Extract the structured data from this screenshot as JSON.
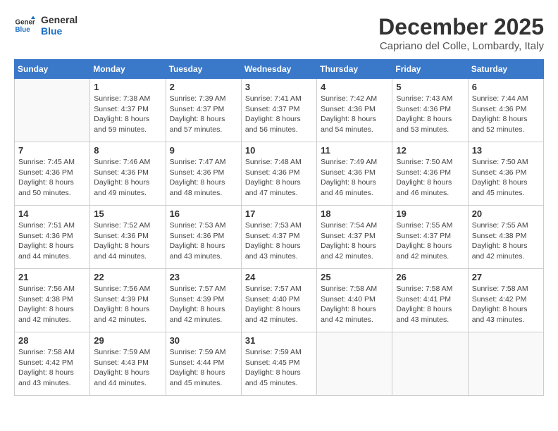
{
  "header": {
    "logo_line1": "General",
    "logo_line2": "Blue",
    "month_title": "December 2025",
    "subtitle": "Capriano del Colle, Lombardy, Italy"
  },
  "weekdays": [
    "Sunday",
    "Monday",
    "Tuesday",
    "Wednesday",
    "Thursday",
    "Friday",
    "Saturday"
  ],
  "weeks": [
    [
      {
        "day": "",
        "info": ""
      },
      {
        "day": "1",
        "info": "Sunrise: 7:38 AM\nSunset: 4:37 PM\nDaylight: 8 hours\nand 59 minutes."
      },
      {
        "day": "2",
        "info": "Sunrise: 7:39 AM\nSunset: 4:37 PM\nDaylight: 8 hours\nand 57 minutes."
      },
      {
        "day": "3",
        "info": "Sunrise: 7:41 AM\nSunset: 4:37 PM\nDaylight: 8 hours\nand 56 minutes."
      },
      {
        "day": "4",
        "info": "Sunrise: 7:42 AM\nSunset: 4:36 PM\nDaylight: 8 hours\nand 54 minutes."
      },
      {
        "day": "5",
        "info": "Sunrise: 7:43 AM\nSunset: 4:36 PM\nDaylight: 8 hours\nand 53 minutes."
      },
      {
        "day": "6",
        "info": "Sunrise: 7:44 AM\nSunset: 4:36 PM\nDaylight: 8 hours\nand 52 minutes."
      }
    ],
    [
      {
        "day": "7",
        "info": "Sunrise: 7:45 AM\nSunset: 4:36 PM\nDaylight: 8 hours\nand 50 minutes."
      },
      {
        "day": "8",
        "info": "Sunrise: 7:46 AM\nSunset: 4:36 PM\nDaylight: 8 hours\nand 49 minutes."
      },
      {
        "day": "9",
        "info": "Sunrise: 7:47 AM\nSunset: 4:36 PM\nDaylight: 8 hours\nand 48 minutes."
      },
      {
        "day": "10",
        "info": "Sunrise: 7:48 AM\nSunset: 4:36 PM\nDaylight: 8 hours\nand 47 minutes."
      },
      {
        "day": "11",
        "info": "Sunrise: 7:49 AM\nSunset: 4:36 PM\nDaylight: 8 hours\nand 46 minutes."
      },
      {
        "day": "12",
        "info": "Sunrise: 7:50 AM\nSunset: 4:36 PM\nDaylight: 8 hours\nand 46 minutes."
      },
      {
        "day": "13",
        "info": "Sunrise: 7:50 AM\nSunset: 4:36 PM\nDaylight: 8 hours\nand 45 minutes."
      }
    ],
    [
      {
        "day": "14",
        "info": "Sunrise: 7:51 AM\nSunset: 4:36 PM\nDaylight: 8 hours\nand 44 minutes."
      },
      {
        "day": "15",
        "info": "Sunrise: 7:52 AM\nSunset: 4:36 PM\nDaylight: 8 hours\nand 44 minutes."
      },
      {
        "day": "16",
        "info": "Sunrise: 7:53 AM\nSunset: 4:36 PM\nDaylight: 8 hours\nand 43 minutes."
      },
      {
        "day": "17",
        "info": "Sunrise: 7:53 AM\nSunset: 4:37 PM\nDaylight: 8 hours\nand 43 minutes."
      },
      {
        "day": "18",
        "info": "Sunrise: 7:54 AM\nSunset: 4:37 PM\nDaylight: 8 hours\nand 42 minutes."
      },
      {
        "day": "19",
        "info": "Sunrise: 7:55 AM\nSunset: 4:37 PM\nDaylight: 8 hours\nand 42 minutes."
      },
      {
        "day": "20",
        "info": "Sunrise: 7:55 AM\nSunset: 4:38 PM\nDaylight: 8 hours\nand 42 minutes."
      }
    ],
    [
      {
        "day": "21",
        "info": "Sunrise: 7:56 AM\nSunset: 4:38 PM\nDaylight: 8 hours\nand 42 minutes."
      },
      {
        "day": "22",
        "info": "Sunrise: 7:56 AM\nSunset: 4:39 PM\nDaylight: 8 hours\nand 42 minutes."
      },
      {
        "day": "23",
        "info": "Sunrise: 7:57 AM\nSunset: 4:39 PM\nDaylight: 8 hours\nand 42 minutes."
      },
      {
        "day": "24",
        "info": "Sunrise: 7:57 AM\nSunset: 4:40 PM\nDaylight: 8 hours\nand 42 minutes."
      },
      {
        "day": "25",
        "info": "Sunrise: 7:58 AM\nSunset: 4:40 PM\nDaylight: 8 hours\nand 42 minutes."
      },
      {
        "day": "26",
        "info": "Sunrise: 7:58 AM\nSunset: 4:41 PM\nDaylight: 8 hours\nand 43 minutes."
      },
      {
        "day": "27",
        "info": "Sunrise: 7:58 AM\nSunset: 4:42 PM\nDaylight: 8 hours\nand 43 minutes."
      }
    ],
    [
      {
        "day": "28",
        "info": "Sunrise: 7:58 AM\nSunset: 4:42 PM\nDaylight: 8 hours\nand 43 minutes."
      },
      {
        "day": "29",
        "info": "Sunrise: 7:59 AM\nSunset: 4:43 PM\nDaylight: 8 hours\nand 44 minutes."
      },
      {
        "day": "30",
        "info": "Sunrise: 7:59 AM\nSunset: 4:44 PM\nDaylight: 8 hours\nand 45 minutes."
      },
      {
        "day": "31",
        "info": "Sunrise: 7:59 AM\nSunset: 4:45 PM\nDaylight: 8 hours\nand 45 minutes."
      },
      {
        "day": "",
        "info": ""
      },
      {
        "day": "",
        "info": ""
      },
      {
        "day": "",
        "info": ""
      }
    ]
  ]
}
